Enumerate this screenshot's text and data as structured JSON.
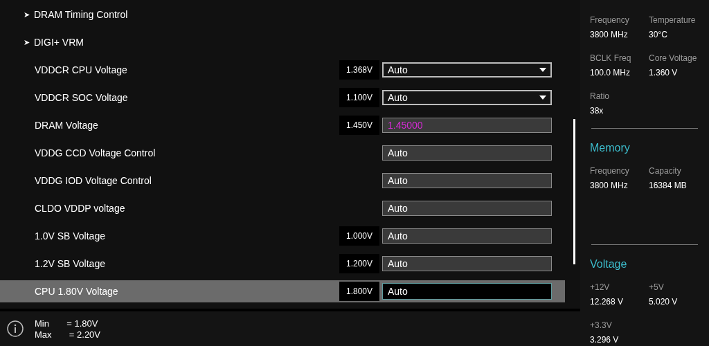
{
  "settings": [
    {
      "kind": "submenu",
      "label": "DRAM Timing Control",
      "arrow": "➤",
      "selected": false
    },
    {
      "kind": "submenu",
      "label": "DIGI+ VRM",
      "arrow": "➤",
      "selected": false
    },
    {
      "kind": "dropdown",
      "label": "VDDCR CPU Voltage",
      "reading": "1.368V",
      "value": "Auto",
      "selected": false
    },
    {
      "kind": "dropdown",
      "label": "VDDCR SOC Voltage",
      "reading": "1.100V",
      "value": "Auto",
      "selected": false
    },
    {
      "kind": "input",
      "label": "DRAM Voltage",
      "reading": "1.450V",
      "value": "1.45000",
      "modified": true,
      "selected": false
    },
    {
      "kind": "input",
      "label": "VDDG CCD Voltage Control",
      "value": "Auto",
      "modified": false,
      "selected": false
    },
    {
      "kind": "input",
      "label": "VDDG IOD Voltage Control",
      "value": "Auto",
      "modified": false,
      "selected": false
    },
    {
      "kind": "input",
      "label": "CLDO VDDP voltage",
      "value": "Auto",
      "modified": false,
      "selected": false
    },
    {
      "kind": "input",
      "label": "1.0V SB Voltage",
      "reading": "1.000V",
      "value": "Auto",
      "modified": false,
      "selected": false
    },
    {
      "kind": "input",
      "label": "1.2V SB Voltage",
      "reading": "1.200V",
      "value": "Auto",
      "modified": false,
      "selected": false
    },
    {
      "kind": "input",
      "label": "CPU 1.80V Voltage",
      "reading": "1.800V",
      "value": "Auto",
      "modified": false,
      "selected": true
    }
  ],
  "help": {
    "lines": [
      "Min       = 1.80V",
      "Max       = 2.20V"
    ]
  },
  "hardware_monitor": {
    "sections": [
      {
        "items": [
          {
            "label": "Frequency",
            "value": "3800 MHz"
          },
          {
            "label": "Temperature",
            "value": "30°C"
          },
          {
            "label": "BCLK Freq",
            "value": "100.0 MHz"
          },
          {
            "label": "Core Voltage",
            "value": "1.360 V"
          },
          {
            "label": "Ratio",
            "value": "38x"
          }
        ]
      },
      {
        "title": "Memory",
        "items": [
          {
            "label": "Frequency",
            "value": "3800 MHz"
          },
          {
            "label": "Capacity",
            "value": "16384 MB"
          }
        ]
      },
      {
        "title": "Voltage",
        "items": [
          {
            "label": "+12V",
            "value": "12.268 V"
          },
          {
            "label": "+5V",
            "value": "5.020 V"
          },
          {
            "label": "+3.3V",
            "value": "3.296 V"
          }
        ]
      }
    ]
  }
}
